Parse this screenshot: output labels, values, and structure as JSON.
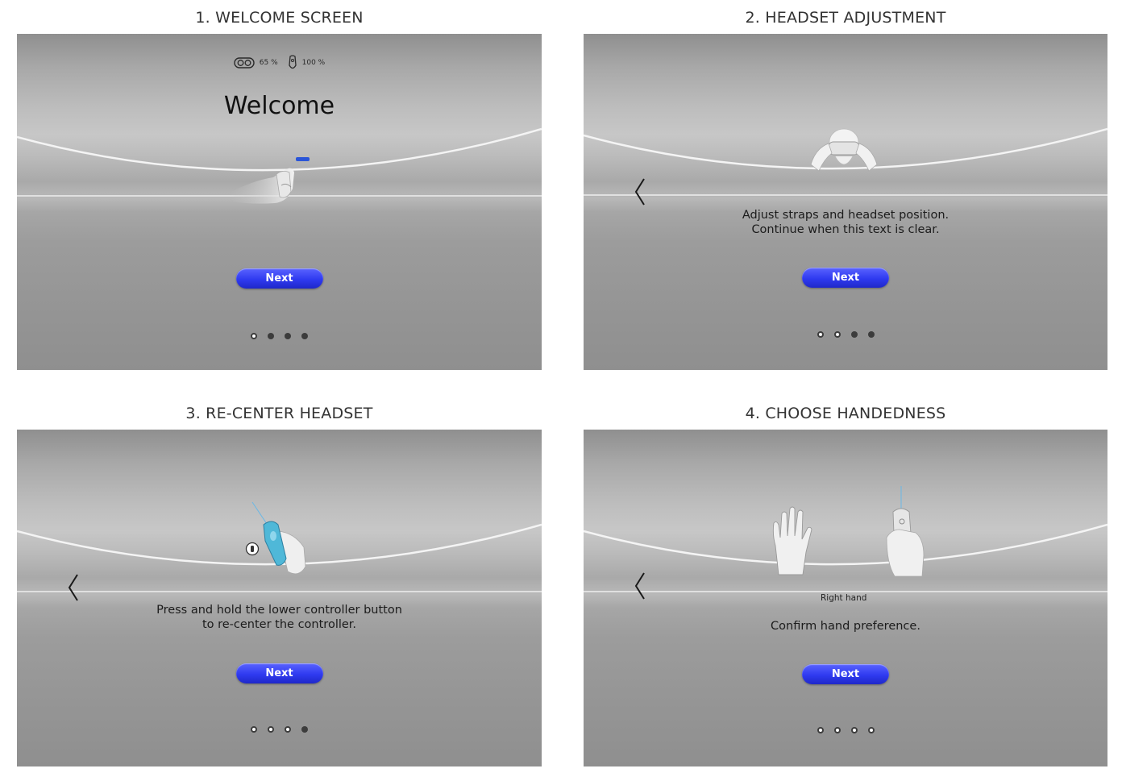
{
  "panels": [
    {
      "caption": "1. WELCOME SCREEN",
      "status": {
        "headset_battery": "65 %",
        "controller_battery": "100 %"
      },
      "headline": "Welcome",
      "next_label": "Next",
      "dots": [
        "completed",
        "upcoming",
        "upcoming",
        "upcoming"
      ]
    },
    {
      "caption": "2. HEADSET ADJUSTMENT",
      "instruction_lines": [
        "Adjust straps and headset position.",
        "Continue when this text is clear."
      ],
      "next_label": "Next",
      "dots": [
        "completed",
        "completed",
        "upcoming",
        "upcoming"
      ]
    },
    {
      "caption": "3. RE-CENTER HEADSET",
      "instruction_lines": [
        "Press and hold the lower controller button",
        "to re-center the controller."
      ],
      "next_label": "Next",
      "dots": [
        "completed",
        "completed",
        "completed",
        "upcoming"
      ]
    },
    {
      "caption": "4. CHOOSE HANDEDNESS",
      "hand_label": "Right hand",
      "instruction_lines": [
        "Confirm hand preference."
      ],
      "next_label": "Next",
      "dots": [
        "completed",
        "completed",
        "completed",
        "completed"
      ]
    }
  ],
  "colors": {
    "button_blue": "#2f3af0",
    "controller_accent": "#4fb8d8",
    "caption_text": "#333333"
  },
  "icons": [
    "headset-icon",
    "controller-icon",
    "back-chevron-icon",
    "hand-icon",
    "controller-button-icon"
  ]
}
